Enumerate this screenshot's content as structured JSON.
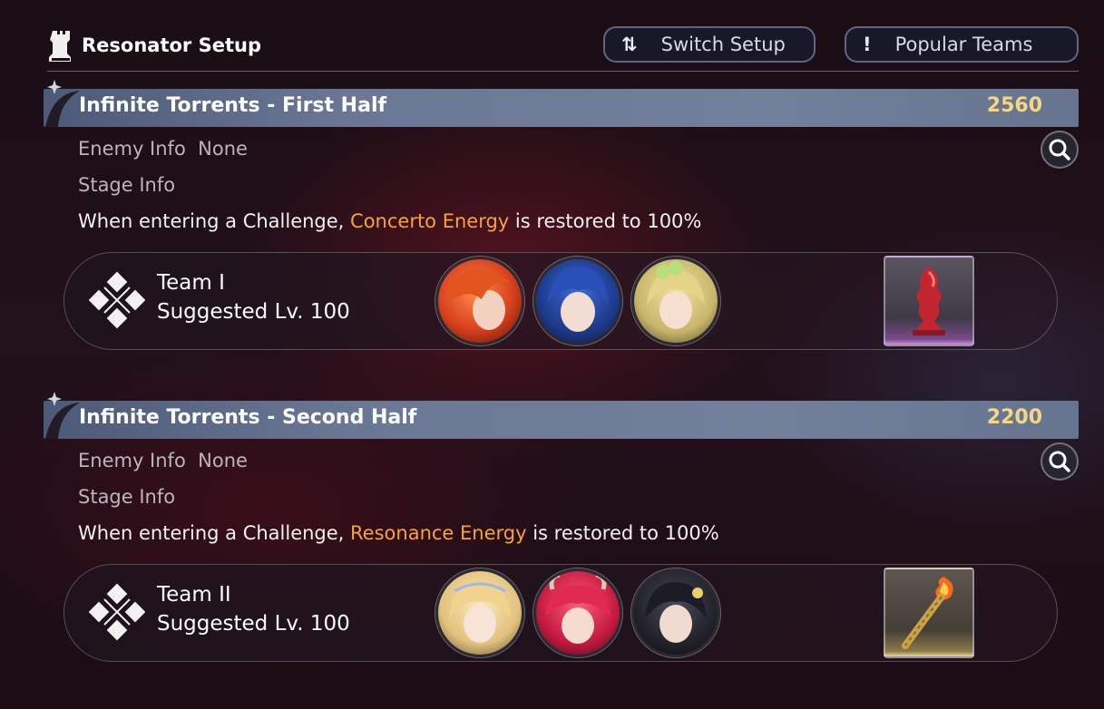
{
  "header": {
    "title": "Resonator Setup",
    "title_icon": "rook-icon",
    "switch_button": {
      "glyph": "⇅",
      "label": "Switch Setup"
    },
    "popular_button": {
      "glyph": "!",
      "label": "Popular Teams"
    }
  },
  "stages": [
    {
      "title": "Infinite Torrents - First Half",
      "score": "2560",
      "enemy_label": "Enemy Info",
      "enemy_value": "None",
      "stage_label": "Stage Info",
      "stage_prefix": "When entering a Challenge, ",
      "stage_highlight": "Concerto Energy",
      "stage_suffix": " is restored to 100%",
      "team": {
        "name": "Team I",
        "level": "Suggested Lv. 100",
        "members": [
          "portrait-red-hair",
          "portrait-blue-hair",
          "portrait-blonde-flower"
        ],
        "item": "red-chess-piece-icon"
      }
    },
    {
      "title": "Infinite Torrents - Second Half",
      "score": "2200",
      "enemy_label": "Enemy Info",
      "enemy_value": "None",
      "stage_label": "Stage Info",
      "stage_prefix": "When entering a Challenge, ",
      "stage_highlight": "Resonance Energy",
      "stage_suffix": " is restored to 100%",
      "team": {
        "name": "Team II",
        "level": "Suggested Lv. 100",
        "members": [
          "portrait-blonde-elf",
          "portrait-red-horns",
          "portrait-black-hair"
        ],
        "item": "flaming-torch-icon"
      }
    }
  ],
  "colors": {
    "accent_orange": "#f4a43b",
    "score_gold": "#f4d685",
    "banner": "#6a7895",
    "background": "#1c0c14"
  }
}
